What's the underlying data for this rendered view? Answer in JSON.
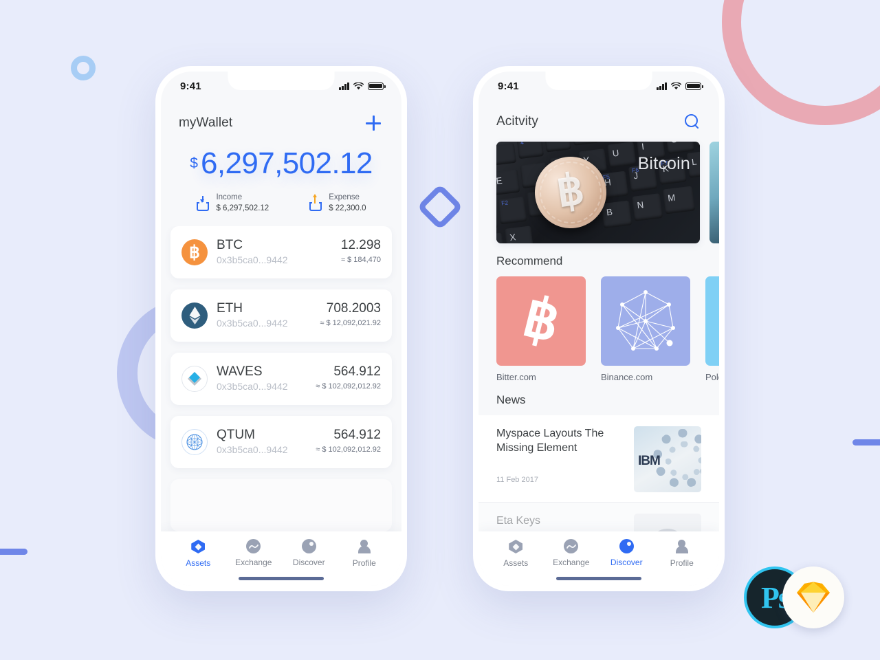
{
  "background": {
    "color": "#e8ecfb",
    "decorations": [
      {
        "name": "pink-arc",
        "color": "#e8a3ae"
      },
      {
        "name": "purple-ring",
        "color": "#b6c1ee"
      },
      {
        "name": "small-blue-circle",
        "color": "#a7cdf5"
      },
      {
        "name": "blue-bar-left",
        "color": "#6f86e8"
      },
      {
        "name": "blue-bar-right",
        "color": "#6f86e8"
      },
      {
        "name": "diamond-outline",
        "color": "#6f86e8"
      }
    ]
  },
  "badges": {
    "photoshop_label": "Ps",
    "sketch_label": "sketch-diamond"
  },
  "phone1": {
    "status": {
      "time": "9:41",
      "signal": "signal-icon",
      "wifi": "wifi-icon",
      "battery": "battery-icon"
    },
    "header": {
      "title": "myWallet",
      "add_icon": "plus-icon"
    },
    "balance": {
      "currency_symbol": "$",
      "amount": "6,297,502.12",
      "color": "#2f6bf3"
    },
    "summary": [
      {
        "icon": "income-icon",
        "label": "Income",
        "value": "$ 6,297,502.12"
      },
      {
        "icon": "expense-icon",
        "label": "Expense",
        "value": "$ 22,300.0"
      }
    ],
    "assets": [
      {
        "icon": "btc-coin-icon",
        "symbol": "BTC",
        "address": "0x3b5ca0...9442",
        "amount": "12.298",
        "usd": "≈ $ 184,470"
      },
      {
        "icon": "eth-coin-icon",
        "symbol": "ETH",
        "address": "0x3b5ca0...9442",
        "amount": "708.2003",
        "usd": "≈ $ 12,092,021.92"
      },
      {
        "icon": "waves-coin-icon",
        "symbol": "WAVES",
        "address": "0x3b5ca0...9442",
        "amount": "564.912",
        "usd": "≈ $ 102,092,012.92"
      },
      {
        "icon": "qtum-coin-icon",
        "symbol": "QTUM",
        "address": "0x3b5ca0...9442",
        "amount": "564.912",
        "usd": "≈ $ 102,092,012.92"
      }
    ],
    "tabs": [
      {
        "icon": "assets-icon",
        "label": "Assets",
        "active": true
      },
      {
        "icon": "exchange-icon",
        "label": "Exchange",
        "active": false
      },
      {
        "icon": "discover-icon",
        "label": "Discover",
        "active": false
      },
      {
        "icon": "profile-icon",
        "label": "Profile",
        "active": false
      }
    ]
  },
  "phone2": {
    "status": {
      "time": "9:41",
      "signal": "signal-icon",
      "wifi": "wifi-icon",
      "battery": "battery-icon"
    },
    "header": {
      "title": "Acitvity",
      "search_icon": "search-icon"
    },
    "banner": {
      "title": "Bitcoin",
      "image": "bitcoin-coin-on-keyboard"
    },
    "recommend": {
      "section_title": "Recommend",
      "items": [
        {
          "label": "Bitter.com",
          "icon": "bitcoin-b-icon",
          "color": "#f09690"
        },
        {
          "label": "Binance.com",
          "icon": "network-graph-icon",
          "color": "#9eaeea"
        },
        {
          "label": "Polonie",
          "icon": "partial-icon",
          "color": "#7fd0f5"
        }
      ]
    },
    "news": {
      "section_title": "News",
      "items": [
        {
          "title": "Myspace Layouts The Missing Element",
          "date": "11 Feb 2017",
          "thumb": "ibm-server-thumbnail"
        },
        {
          "title": "Eta Keys",
          "date": "",
          "thumb": "avatar-thumbnail"
        }
      ]
    },
    "tabs": [
      {
        "icon": "assets-icon",
        "label": "Assets",
        "active": false
      },
      {
        "icon": "exchange-icon",
        "label": "Exchange",
        "active": false
      },
      {
        "icon": "discover-icon",
        "label": "Discover",
        "active": true
      },
      {
        "icon": "profile-icon",
        "label": "Profile",
        "active": false
      }
    ]
  }
}
